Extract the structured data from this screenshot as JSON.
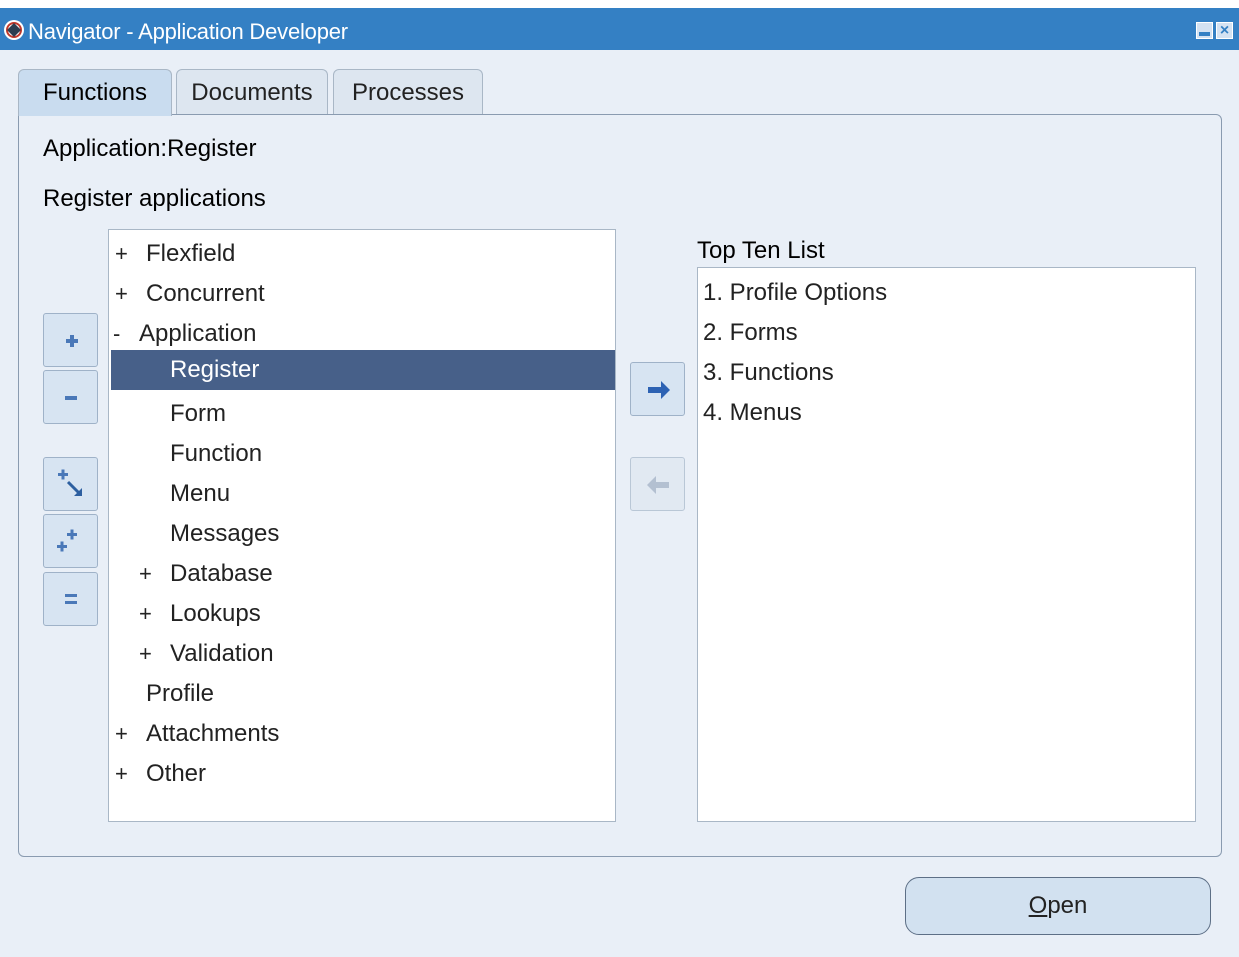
{
  "window": {
    "title": "Navigator - Application Developer",
    "icon": "oracle-forms-icon"
  },
  "tabs": [
    {
      "label": "Functions",
      "active": true
    },
    {
      "label": "Documents",
      "active": false
    },
    {
      "label": "Processes",
      "active": false
    }
  ],
  "context": {
    "application_label": "Application:Register",
    "description": "Register applications"
  },
  "tree": {
    "items": [
      {
        "expander": "+",
        "label": "Flexfield"
      },
      {
        "expander": "+",
        "label": "Concurrent"
      },
      {
        "expander": "-",
        "label": "Application"
      },
      {
        "expander": "",
        "label": "Register",
        "selected": true
      },
      {
        "expander": "",
        "label": "Form"
      },
      {
        "expander": "",
        "label": "Function"
      },
      {
        "expander": "",
        "label": "Menu"
      },
      {
        "expander": "",
        "label": "Messages"
      },
      {
        "expander": "+",
        "label": "Database"
      },
      {
        "expander": "+",
        "label": "Lookups"
      },
      {
        "expander": "+",
        "label": "Validation"
      },
      {
        "expander": "",
        "label": "Profile"
      },
      {
        "expander": "+",
        "label": "Attachments"
      },
      {
        "expander": "+",
        "label": "Other"
      }
    ]
  },
  "top_ten": {
    "label": "Top Ten List",
    "items": [
      "1. Profile Options",
      "2. Forms",
      "3. Functions",
      "4. Menus"
    ]
  },
  "buttons": {
    "open_prefix": "O",
    "open_rest": "pen"
  },
  "colors": {
    "titlebar": "#3480c4",
    "selection": "#476089",
    "background": "#e9eff7"
  }
}
